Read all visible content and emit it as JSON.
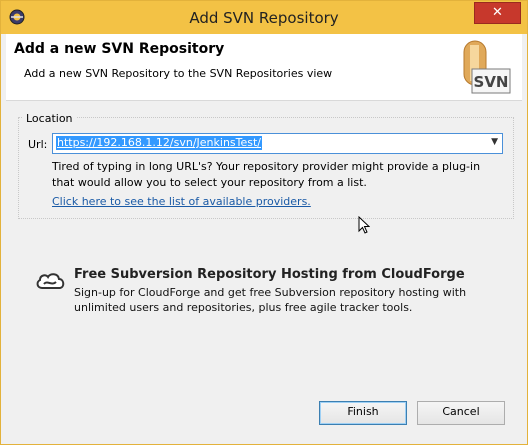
{
  "window": {
    "title": "Add SVN Repository",
    "close_label": "✕"
  },
  "header": {
    "title": "Add a new SVN Repository",
    "description": "Add a new SVN Repository to the SVN Repositories view",
    "logo_text": "SVN"
  },
  "location": {
    "group_label": "Location",
    "url_label": "Url:",
    "url_value": "https://192.168.1.12/svn/JenkinsTest/",
    "hint": "Tired of typing in long URL's?  Your repository provider might provide a plug-in that would allow you to select your repository from a list.",
    "providers_link": "Click here to see the list of available providers."
  },
  "cloudforge": {
    "title": "Free Subversion Repository Hosting from CloudForge",
    "description": "Sign-up for CloudForge and get free Subversion repository hosting with unlimited users and repositories, plus free agile tracker tools."
  },
  "buttons": {
    "finish": "Finish",
    "cancel": "Cancel"
  },
  "colors": {
    "titlebar": "#f3c245",
    "close": "#c7382c",
    "selection": "#3399ff",
    "link": "#1a5aa6"
  }
}
